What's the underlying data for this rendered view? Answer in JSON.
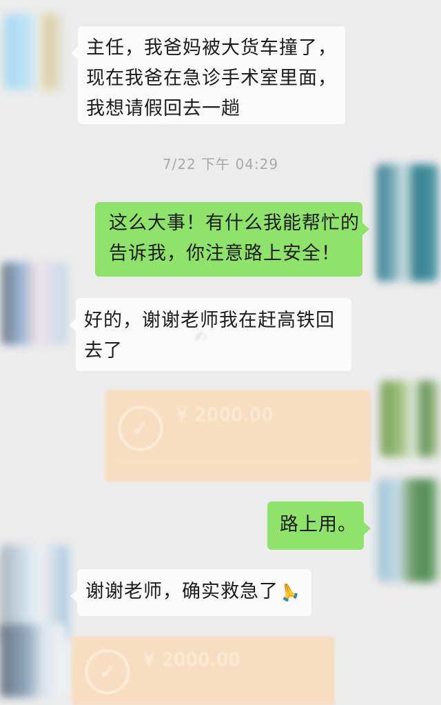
{
  "messages": [
    {
      "lines": [
        "主任，我爸妈被大货车撞了，",
        "现在我爸在急诊手术室里面，",
        "我想请假回去一趟"
      ]
    },
    {
      "timestamp": "7/22 下午 04:29"
    },
    {
      "lines": [
        "这么大事！有什么我能帮忙的",
        "告诉我，你注意路上安全！"
      ]
    },
    {
      "lines": [
        "好的，谢谢老师我在赶高铁回",
        "去了"
      ]
    },
    {
      "transfer_amount": "¥ 2000.00"
    },
    {
      "lines": [
        "路上用。"
      ]
    },
    {
      "lines": [
        "谢谢老师，确实救急了"
      ],
      "emoji": "🙏"
    },
    {
      "transfer_amount": "¥ 2000.00"
    }
  ],
  "colors": {
    "self_bubble": "#8fe36a",
    "other_bubble": "#fbfbfb",
    "transfer_card": "#f7ddc2",
    "background": "#ececec"
  },
  "icons": {
    "transfer": "check-circle-icon"
  }
}
